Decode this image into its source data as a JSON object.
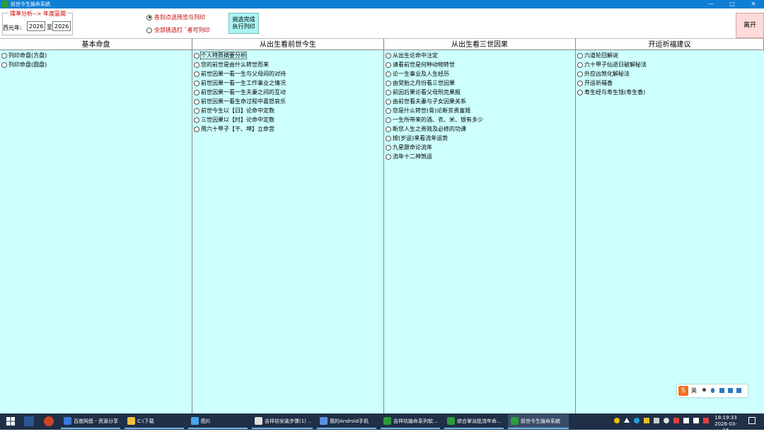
{
  "window": {
    "title": "前世今生論命系統",
    "buttons": [
      "—",
      "□",
      "✕"
    ]
  },
  "toolbar": {
    "range_legend": "擇準分析--> 年度區間",
    "western_year_label": "西元年:",
    "year_from": "2026",
    "to_label": "至",
    "year_to": "2026",
    "radio_preview": "各别点选预览与列印",
    "radio_all": "全部挑选打 ˇ者可列印",
    "print_button": [
      "挑选完成",
      "执行列印"
    ],
    "leave_button": "离开"
  },
  "columns": [
    {
      "header": "基本命盘",
      "items": [
        "列印命盘(方盘)",
        "列印命盘(圆盘)"
      ]
    },
    {
      "header": "从出生看前世今生",
      "items": [
        "个人特质摘要分析",
        "您的前世是由什么转世而来",
        "前世因果一看一生与父母间的对待",
        "前世因果一看一生工作事业之情况",
        "前世因果一看一生夫妻之间的互动",
        "前世因果一看生命过程中喜怒哀乐",
        "前世今生以【日】论命中定数",
        "三世因果以【时】论命中定数",
        "用六十甲子【干、坤】立命宫"
      ]
    },
    {
      "header": "从出生看三世因果",
      "items": [
        "从出生论命中注定",
        "请看前世是何种动物转世",
        "论一生事业及人生经历",
        "由受胎之月份看三世因果",
        "前因后果论看父母刑克果报",
        "由前世看夫妻与子女因果关系",
        "您是什么转世(骨)论断贫贵富贱",
        "一生所带来的酒、衣、米、银有多少",
        "断您人生之贵贱及必修的功课",
        "按(岁运)来看流年运势",
        "九星跟命论流年",
        "流年十二神煞运"
      ]
    },
    {
      "header": "开运祈福建议",
      "items": [
        "六道轮回解说",
        "六十甲子仙逝日破解秘法",
        "外应凶煞化解秘法",
        "开运祈福香",
        "寿生经与寿生钱(寿生香)"
      ]
    }
  ],
  "ime": {
    "label": "英"
  },
  "taskbar": {
    "tasks": [
      "百度网盘 - 资源分享",
      "C:\\下载",
      "图片",
      "吉祥坊安装步骤(1) ...",
      "我的Android手机",
      "吉祥坊論命系列软...",
      "综合掌派批流年命...",
      "前世今生論命系統"
    ],
    "clock_time": "18:19:33",
    "clock_date": "2026-03-16"
  }
}
